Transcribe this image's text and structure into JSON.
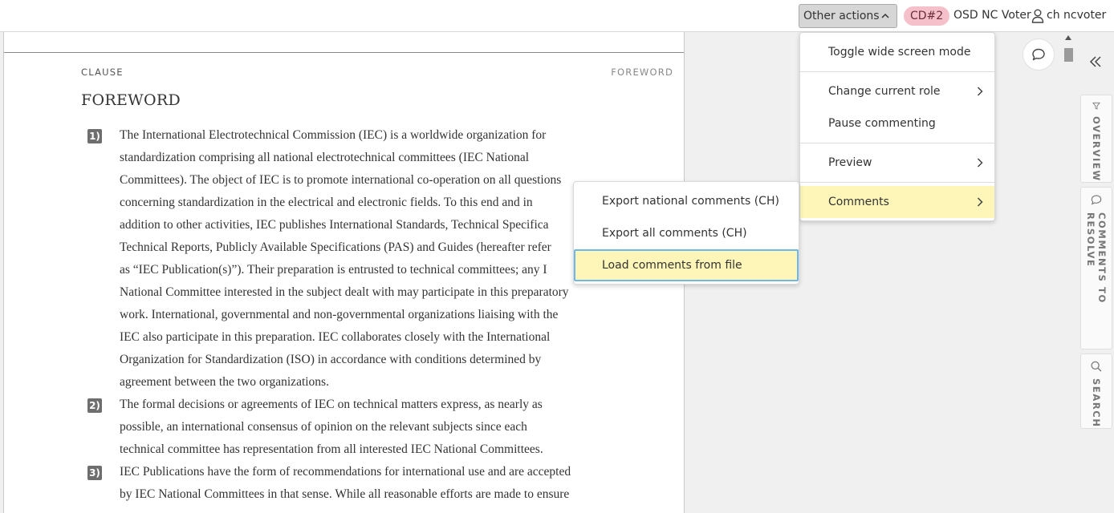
{
  "topbar": {
    "other_actions_label": "Other actions",
    "stage_badge": "CD#2",
    "role": "OSD NC Voter",
    "user": "ch ncvoter"
  },
  "document": {
    "clause_label": "CLAUSE",
    "clause_right": "FOREWORD",
    "title": "FOREWORD",
    "paragraphs": [
      {
        "num": "1)",
        "lines": [
          "The International Electrotechnical Commission (IEC) is a worldwide organization for",
          "standardization comprising all national electrotechnical committees (IEC National",
          "Committees). The object of IEC is to promote international co-operation on all questions",
          "concerning standardization in the electrical and electronic fields. To this end and in",
          "addition to other activities, IEC publishes International Standards, Technical Specifica",
          "Technical Reports, Publicly Available Specifications (PAS) and Guides (hereafter refer",
          "as “IEC Publication(s)”). Their preparation is entrusted to technical committees; any I",
          "National Committee interested in the subject dealt with may participate in this preparatory",
          "work. International, governmental and non-governmental organizations liaising with the",
          "IEC also participate in this preparation. IEC collaborates closely with the International",
          "Organization for Standardization (ISO) in accordance with conditions determined by",
          "agreement between the two organizations."
        ]
      },
      {
        "num": "2)",
        "lines": [
          "The formal decisions or agreements of IEC on technical matters express, as nearly as",
          "possible, an international consensus of opinion on the relevant subjects since each",
          "technical committee has representation from all interested IEC National Committees."
        ]
      },
      {
        "num": "3)",
        "lines": [
          "IEC Publications have the form of recommendations for international use and are accepted",
          "by IEC National Committees in that sense. While all reasonable efforts are made to ensure"
        ]
      }
    ]
  },
  "menu": {
    "items": [
      {
        "label": "Toggle wide screen mode",
        "has_submenu": false
      },
      {
        "label": "Change current role",
        "has_submenu": true
      },
      {
        "label": "Pause commenting",
        "has_submenu": false
      },
      {
        "label": "Preview",
        "has_submenu": true
      },
      {
        "label": "Comments",
        "has_submenu": true,
        "active": true
      }
    ],
    "submenu": [
      {
        "label": "Export national comments (CH)"
      },
      {
        "label": "Export all comments (CH)"
      },
      {
        "label": "Load comments from file",
        "active": true
      }
    ]
  },
  "rail": {
    "tabs": [
      {
        "label": "OVERVIEW",
        "icon": "filter-icon"
      },
      {
        "label": "COMMENTS TO RESOLVE",
        "icon": "comment-icon"
      },
      {
        "label": "SEARCH",
        "icon": "search-icon"
      }
    ]
  },
  "colors": {
    "active_bg": "#fdf6b8",
    "badge_bg": "#f6c0cb",
    "focus_border": "#6fb7e8"
  }
}
